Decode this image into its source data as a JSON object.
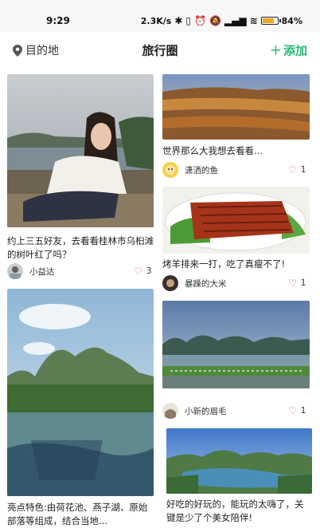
{
  "status": {
    "time": "9:29",
    "speed": "2.3K/s",
    "battery": "84",
    "battery_fraction": 0.84,
    "icons": [
      "bluetooth-icon",
      "vibrate-icon",
      "alarm-icon",
      "mute-icon",
      "signal-icon",
      "wifi-icon",
      "battery-icon"
    ]
  },
  "nav": {
    "location_icon": "location-pin-icon",
    "location_label": "目的地",
    "title": "旅行圈",
    "add_icon": "plus-icon",
    "add_label": "添加"
  },
  "colors": {
    "accent": "#2bb673",
    "heart": "#e2534b"
  },
  "feed": {
    "left": [
      {
        "title": "约上三五好友，去看看桂林市乌桕滩的树叶红了吗？",
        "user": "小益达",
        "likes": "3"
      },
      {
        "title": "亮点特色:由荷花池、燕子湖、原始部落等组成，结合当地...",
        "user": "",
        "likes": ""
      }
    ],
    "right": [
      {
        "title": "世界那么大我想去看看...",
        "user": "潇洒的鱼",
        "likes": "1"
      },
      {
        "title": "烤羊排来一打，吃了真瘦不了!",
        "user": "暴躁的大米",
        "likes": "1"
      },
      {
        "title": "",
        "user": "小新的眉毛",
        "likes": "1"
      },
      {
        "title": "好吃的好玩的，能玩的太嗨了，关键是少了个美女陪伴!",
        "user": "",
        "likes": ""
      }
    ]
  }
}
